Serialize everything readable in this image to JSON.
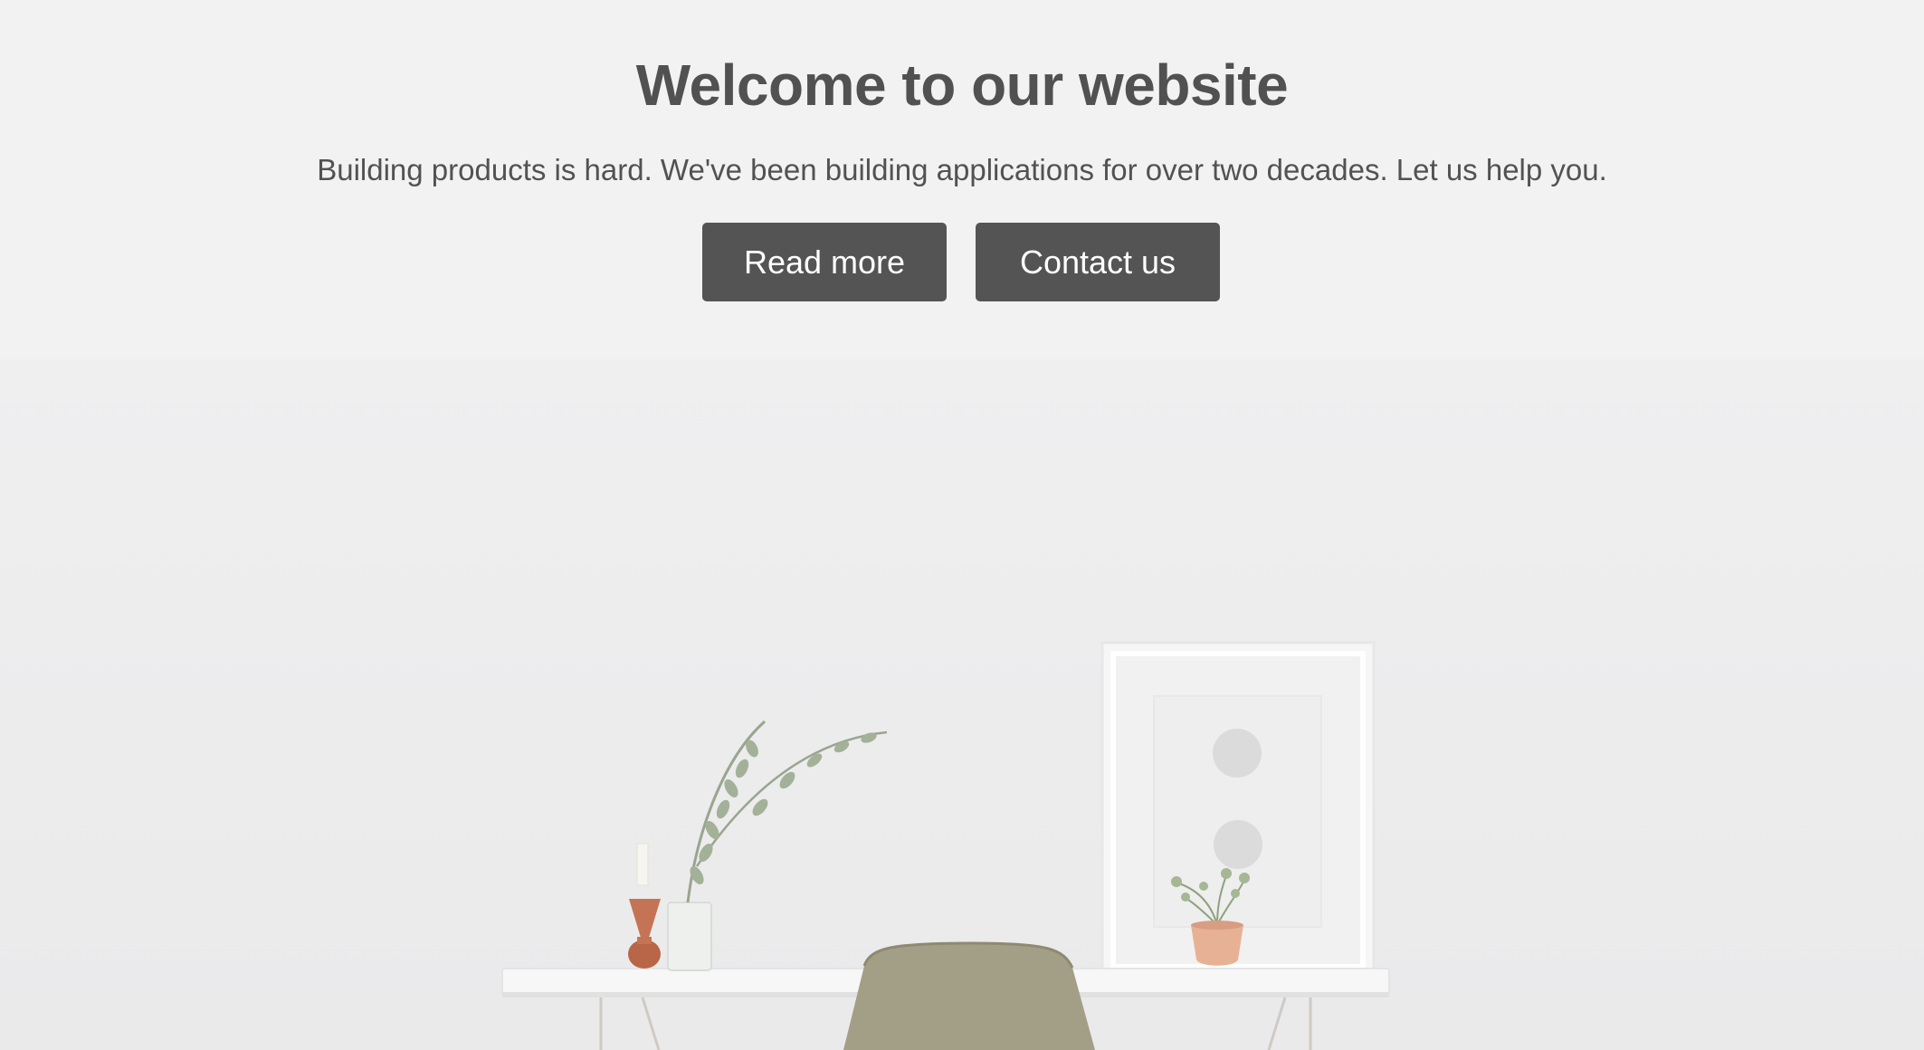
{
  "hero": {
    "title": "Welcome to our website",
    "subtitle": "Building products is hard. We've been building applications for over two decades. Let us help you.",
    "buttons": {
      "read_more": "Read more",
      "contact": "Contact us"
    }
  },
  "colors": {
    "background": "#f2f2f2",
    "text": "#515151",
    "button_bg": "#545454",
    "button_text": "#ffffff"
  },
  "icons": [
    "plant-vase-icon",
    "candle-holder-icon",
    "picture-frame-icon",
    "potted-plant-icon",
    "chair-icon",
    "desk-icon"
  ]
}
